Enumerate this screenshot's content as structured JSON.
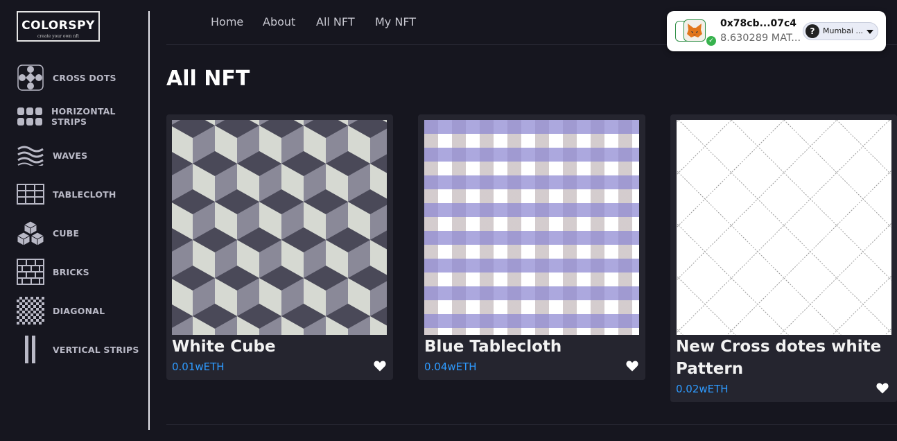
{
  "logo": {
    "title": "COLORSPY",
    "tagline": "create your own nft"
  },
  "sidebar": {
    "items": [
      {
        "label": "CROSS DOTS",
        "icon": "cross-dots-icon"
      },
      {
        "label": "HORIZONTAL STRIPS",
        "icon": "horizontal-strips-icon"
      },
      {
        "label": "WAVES",
        "icon": "waves-icon"
      },
      {
        "label": "TABLECLOTH",
        "icon": "tablecloth-icon"
      },
      {
        "label": "CUBE",
        "icon": "cube-icon"
      },
      {
        "label": "BRICKS",
        "icon": "bricks-icon"
      },
      {
        "label": "DIAGONAL",
        "icon": "diagonal-icon"
      },
      {
        "label": "VERTICAL STRIPS",
        "icon": "vertical-strips-icon"
      }
    ]
  },
  "nav": {
    "home": "Home",
    "about": "About",
    "all_nft": "All NFT",
    "my_nft": "My NFT"
  },
  "wallet": {
    "address": "0x78cb...07c4",
    "balance": "8.630289 MAT...",
    "network": "Mumbai ...",
    "network_help": "?",
    "avatar_icon": "metamask-fox-icon",
    "connected_check": "✓"
  },
  "main": {
    "title": "All NFT",
    "cards": [
      {
        "name": "White Cube",
        "price": "0.01wETH",
        "pattern": "cube"
      },
      {
        "name": "Blue Tablecloth",
        "price": "0.04wETH",
        "pattern": "tablecloth"
      },
      {
        "name": "New Cross dotes white Pattern",
        "price": "0.02wETH",
        "pattern": "cross-dots"
      }
    ]
  },
  "colors": {
    "background": "#16161f",
    "card": "#25252f",
    "price": "#2e9bff",
    "cube_light": "#d6d9d2",
    "cube_mid": "#8a8998",
    "cube_dark": "#4a4958",
    "tablecloth_stripe": "#a9a6d8",
    "tablecloth_vertical": "#cfc7c9"
  }
}
